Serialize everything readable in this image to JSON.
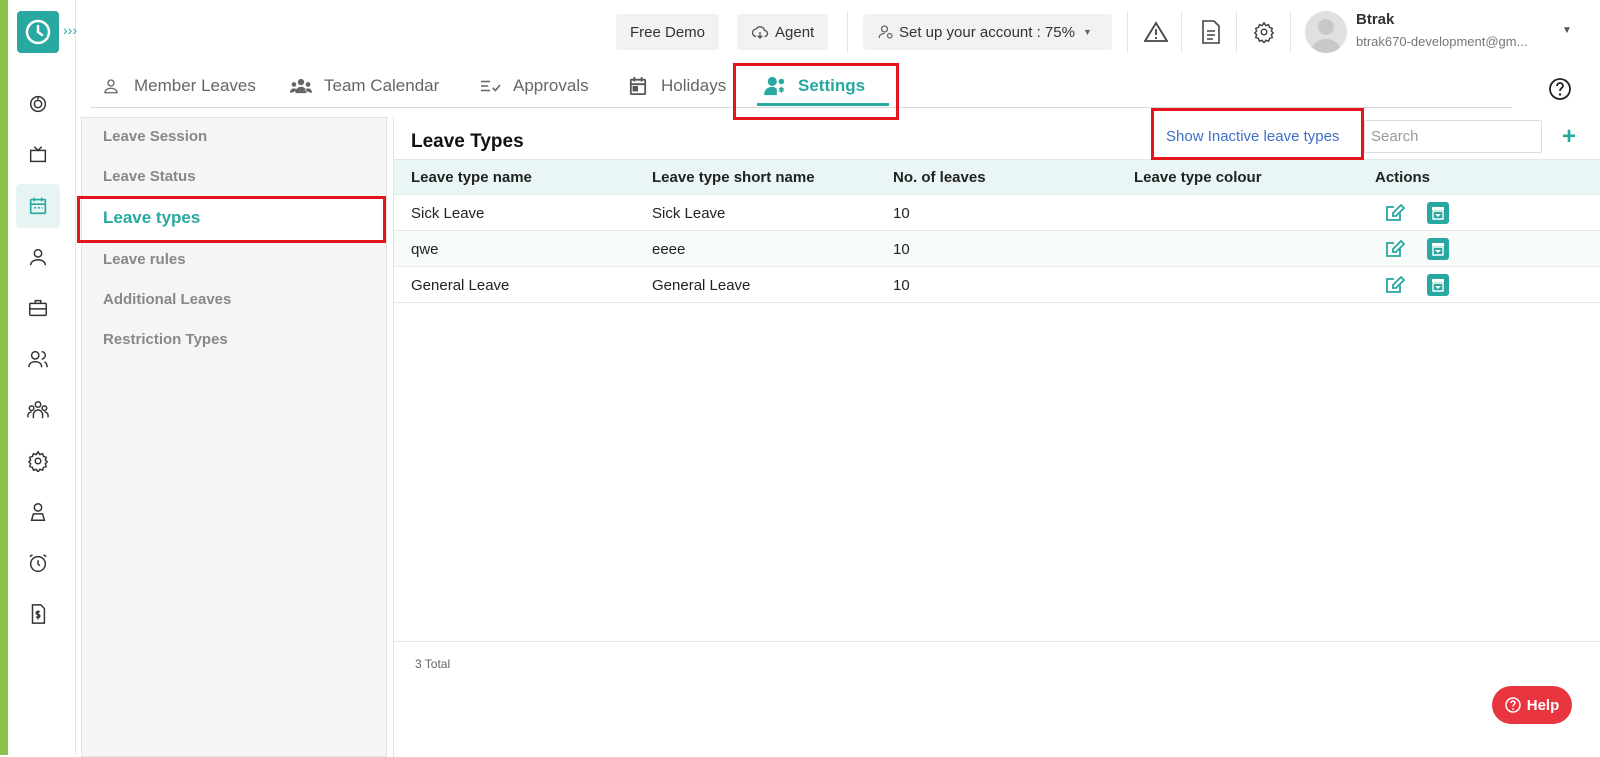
{
  "topbar": {
    "free_demo": "Free Demo",
    "agent": "Agent",
    "setup": "Set up your account : 75%",
    "user_name": "Btrak",
    "user_email": "btrak670-development@gm..."
  },
  "tabs": [
    {
      "label": "Member Leaves",
      "icon": "person-icon"
    },
    {
      "label": "Team Calendar",
      "icon": "group-icon"
    },
    {
      "label": "Approvals",
      "icon": "checklist-icon"
    },
    {
      "label": "Holidays",
      "icon": "calendar-icon"
    },
    {
      "label": "Settings",
      "icon": "person-gear-icon"
    }
  ],
  "sidebar": {
    "items": [
      {
        "label": "Leave Session"
      },
      {
        "label": "Leave Status"
      },
      {
        "label": "Leave types"
      },
      {
        "label": "Leave rules"
      },
      {
        "label": "Additional Leaves"
      },
      {
        "label": "Restriction Types"
      }
    ]
  },
  "main": {
    "title": "Leave Types",
    "inactive_link": "Show Inactive leave types",
    "search_placeholder": "Search",
    "columns": [
      "Leave type name",
      "Leave type short name",
      "No. of leaves",
      "Leave type colour",
      "Actions"
    ],
    "rows": [
      {
        "name": "Sick Leave",
        "short": "Sick Leave",
        "count": "10"
      },
      {
        "name": "qwe",
        "short": "eeee",
        "count": "10"
      },
      {
        "name": "General Leave",
        "short": "General Leave",
        "count": "10"
      }
    ],
    "total": "3 Total"
  },
  "help_button": "Help",
  "colors": {
    "accent": "#28a8a0",
    "highlight": "#e5131b",
    "link": "#3f6fc8",
    "help": "#e8353f"
  }
}
